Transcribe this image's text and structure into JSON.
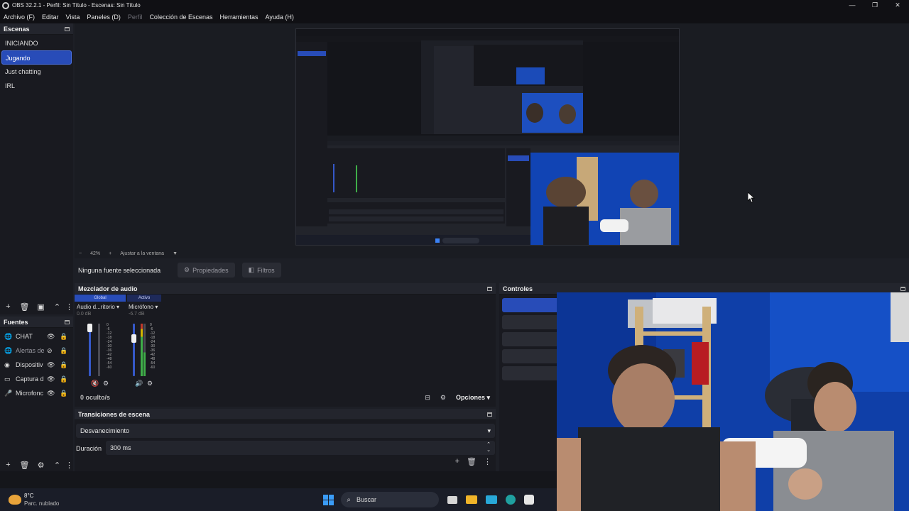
{
  "window": {
    "title": "OBS 32.2.1 - Perfil: Sin Título - Escenas: Sin Título",
    "controls": [
      "—",
      "❐",
      "✕"
    ]
  },
  "menu": [
    {
      "label": "Archivo (F)",
      "enabled": true
    },
    {
      "label": "Editar",
      "enabled": true
    },
    {
      "label": "Vista",
      "enabled": true
    },
    {
      "label": "Paneles (D)",
      "enabled": true
    },
    {
      "label": "Perfil",
      "enabled": false
    },
    {
      "label": "Colección de Escenas",
      "enabled": true
    },
    {
      "label": "Herramientas",
      "enabled": true
    },
    {
      "label": "Ayuda (H)",
      "enabled": true
    }
  ],
  "scenes": {
    "title": "Escenas",
    "items": [
      "INICIANDO",
      "Jugando",
      "Just chatting",
      "IRL"
    ],
    "selected": 1
  },
  "sources": {
    "title": "Fuentes",
    "items": [
      {
        "label": "CHAT",
        "icon": "globe-icon",
        "visible": true
      },
      {
        "label": "Alertas de",
        "icon": "globe-icon",
        "visible": false
      },
      {
        "label": "Dispositiv",
        "icon": "camera-icon",
        "visible": true
      },
      {
        "label": "Captura d",
        "icon": "monitor-icon",
        "visible": true
      },
      {
        "label": "Microfonc",
        "icon": "microphone-icon",
        "visible": true
      }
    ]
  },
  "preview": {
    "zoom_minus": "−",
    "zoom": "42%",
    "zoom_plus": "+",
    "fit": "Ajustar a la ventana"
  },
  "properties_bar": {
    "no_source": "Ninguna fuente seleccionada",
    "properties": "Propiedades",
    "filters": "Filtros"
  },
  "mixer": {
    "title": "Mezclador de audio",
    "tab_global": "Global",
    "tab_active": "Activo",
    "channels": [
      {
        "name": "Audio d...ritorio",
        "db": "0.0 dB",
        "level": 0.0,
        "muted": true
      },
      {
        "name": "Micrófono",
        "db": "-6.7 dB",
        "level": 0.45,
        "muted": false
      }
    ],
    "scale": [
      "0",
      "-6",
      "-12",
      "-18",
      "-24",
      "-30",
      "-36",
      "-42",
      "-48",
      "-54",
      "-60"
    ],
    "hidden": "0 oculto/s",
    "options": "Opciones"
  },
  "transitions": {
    "title": "Transiciones de escena",
    "selected": "Desvanecimiento",
    "duration_label": "Duración",
    "duration": "300 ms"
  },
  "controls": {
    "title": "Controles"
  },
  "taskbar": {
    "weather_temp": "8°C",
    "weather_desc": "Parc. nublado",
    "search": "Buscar"
  },
  "colors": {
    "accent": "#284cb8",
    "panel": "#191a20",
    "background": "#1d1f26",
    "wall": "#1040b0"
  }
}
